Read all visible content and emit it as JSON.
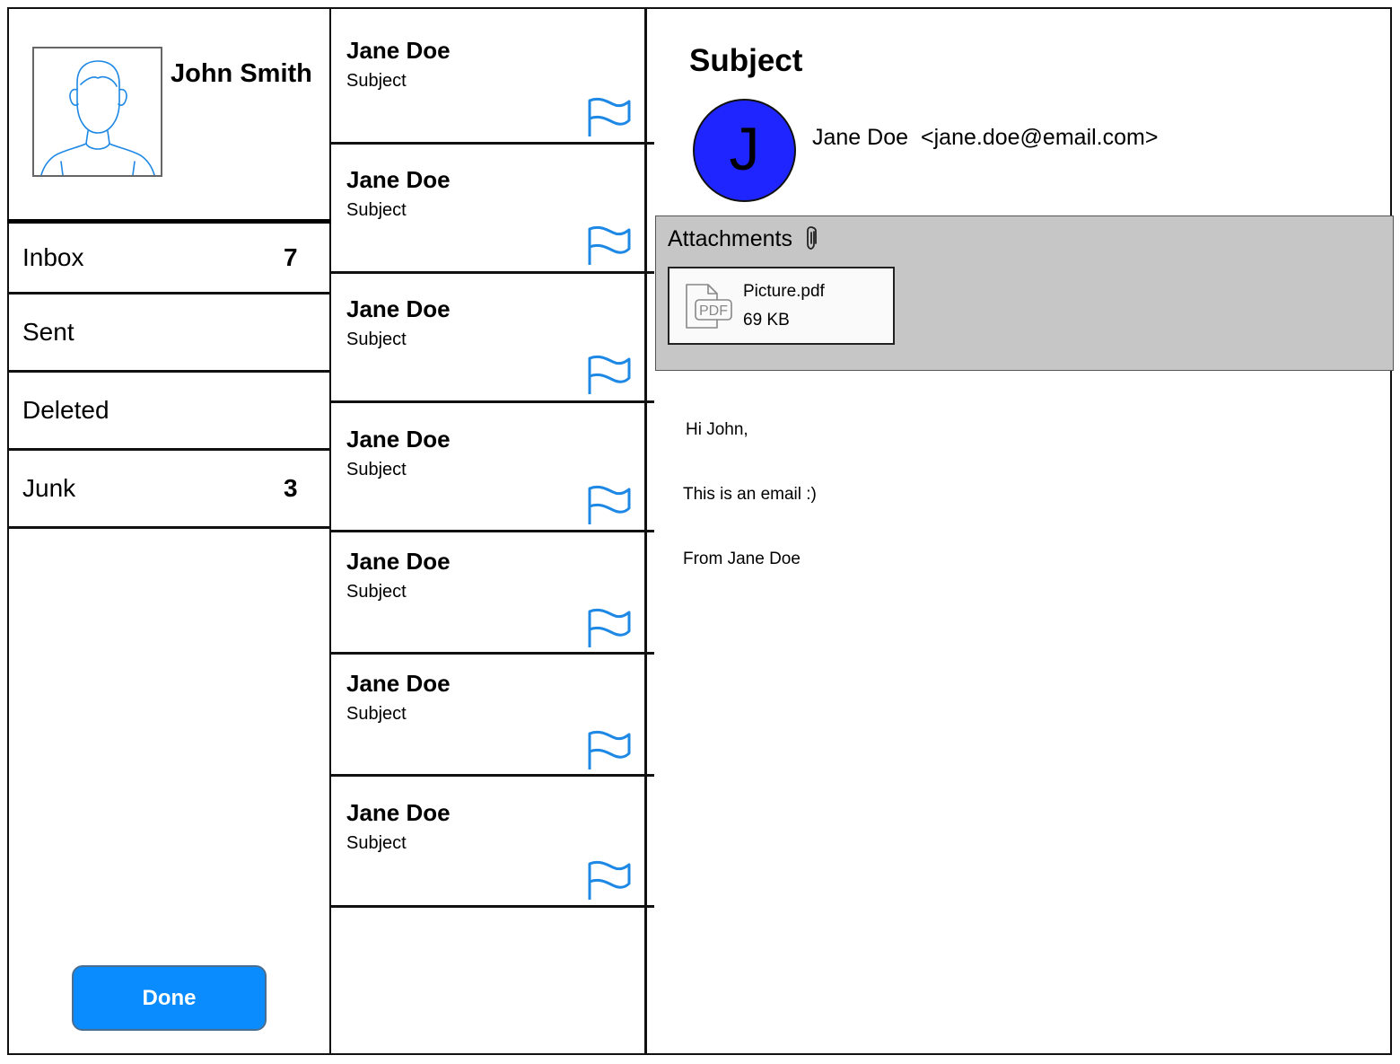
{
  "user": {
    "name": "John Smith"
  },
  "folders": [
    {
      "label": "Inbox",
      "count": "7"
    },
    {
      "label": "Sent",
      "count": ""
    },
    {
      "label": "Deleted",
      "count": ""
    },
    {
      "label": "Junk",
      "count": "3"
    }
  ],
  "done_label": "Done",
  "messages": [
    {
      "from": "Jane Doe",
      "subject": "Subject"
    },
    {
      "from": "Jane Doe",
      "subject": "Subject"
    },
    {
      "from": "Jane Doe",
      "subject": "Subject"
    },
    {
      "from": "Jane Doe",
      "subject": "Subject"
    },
    {
      "from": "Jane Doe",
      "subject": "Subject"
    },
    {
      "from": "Jane Doe",
      "subject": "Subject"
    },
    {
      "from": "Jane Doe",
      "subject": "Subject"
    }
  ],
  "email": {
    "subject": "Subject",
    "sender_initial": "J",
    "sender_name": "Jane Doe",
    "sender_email": "<jane.doe@email.com>",
    "attachments_label": "Attachments",
    "attachment": {
      "name": "Picture.pdf",
      "size": "69 KB",
      "type_label": "PDF"
    },
    "body": [
      "Hi John,",
      "This is an email :)",
      "From Jane Doe"
    ]
  },
  "icons": {
    "avatar": "user-silhouette-icon",
    "flag": "flag-icon",
    "attachment": "paperclip-icon",
    "file": "pdf-file-icon"
  },
  "colors": {
    "accent": "#0a8cff",
    "sender_avatar": "#1f25ff",
    "flag": "#1e88e5",
    "attachment_panel": "#c6c6c6"
  }
}
